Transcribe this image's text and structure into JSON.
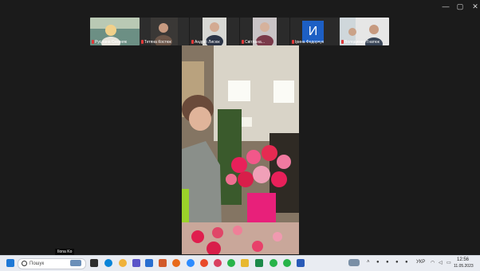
{
  "window": {
    "minimize": "—",
    "maximize": "▢",
    "close": "✕"
  },
  "participants": [
    {
      "name": "Руслана Скорняк"
    },
    {
      "name": "Тетяна Костюк"
    },
    {
      "name": "Андрій Лисюк"
    },
    {
      "name": "Світлана..."
    },
    {
      "name": "Ірина Федорчук",
      "initial": "И"
    },
    {
      "name": "Володимир Гнатюк"
    }
  ],
  "speaker": {
    "name": "Ilona Ko"
  },
  "taskbar": {
    "search_placeholder": "Пошук",
    "time": "12:56",
    "date": "11.05.2023",
    "lang": "УКР"
  }
}
